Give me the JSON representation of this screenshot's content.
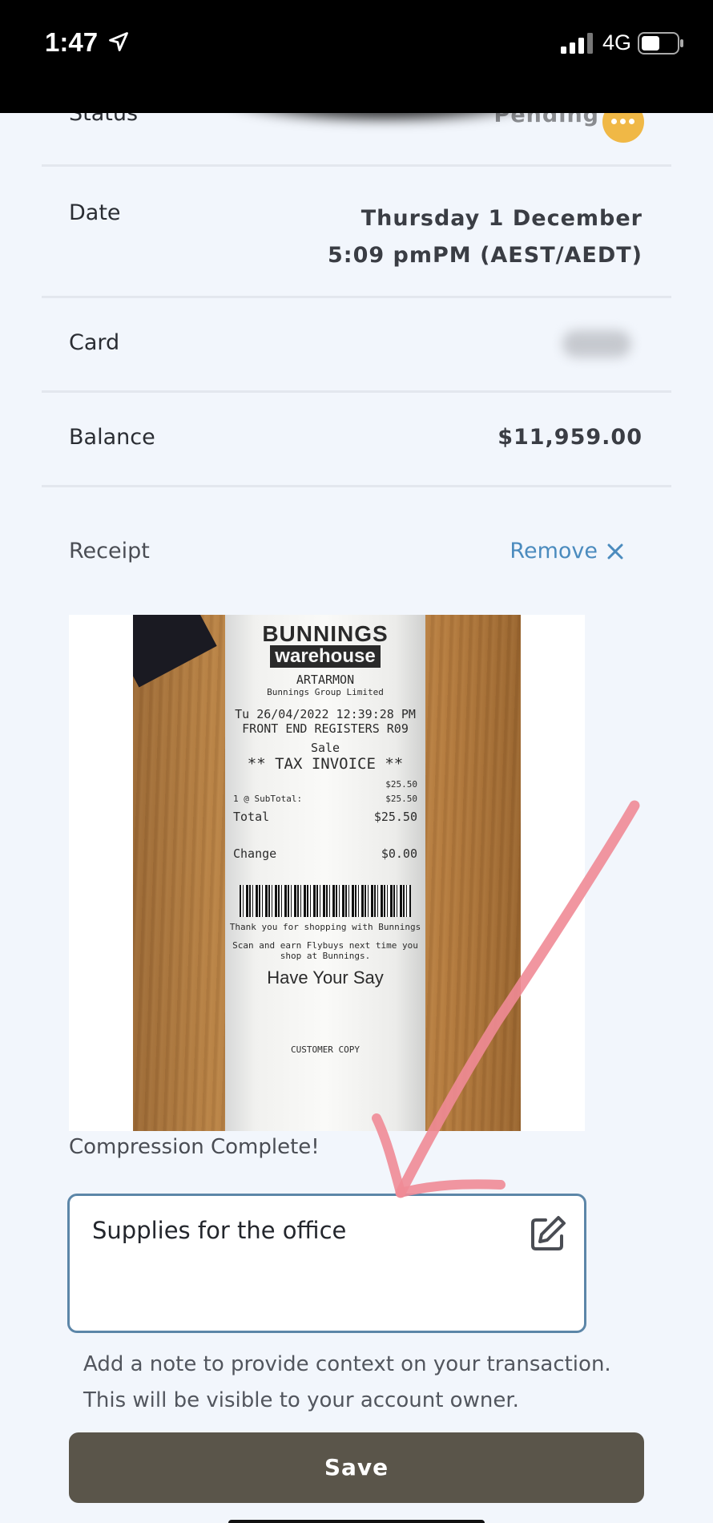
{
  "status_bar": {
    "time": "1:47",
    "network": "4G",
    "icons": [
      "location-arrow-icon",
      "signal-icon",
      "battery-icon"
    ]
  },
  "status_row": {
    "label": "Status",
    "value": "Pending",
    "icon": "more-dots-icon"
  },
  "date_row": {
    "label": "Date",
    "line1": "Thursday 1 December",
    "line2": "5:09 pmPM (AEST/AEDT)"
  },
  "card_row": {
    "label": "Card"
  },
  "balance_row": {
    "label": "Balance",
    "value": "$11,959.00"
  },
  "receipt": {
    "label": "Receipt",
    "remove_label": "Remove",
    "image": {
      "brand_line1": "BUNNINGS",
      "brand_line2": "warehouse",
      "store": "ARTARMON",
      "company": "Bunnings Group Limited",
      "datetime": "Tu 26/04/2022 12:39:28 PM",
      "registers": "FRONT END REGISTERS R09",
      "sale": "Sale",
      "tax_invoice": "** TAX INVOICE **",
      "item_price": "$25.50",
      "subtotal_label": "1 @ SubTotal:",
      "subtotal": "$25.50",
      "total_label": "Total",
      "total": "$25.50",
      "change_label": "Change",
      "change": "$0.00",
      "thanks": "Thank you for shopping with Bunnings",
      "flybuys": "Scan and earn Flybuys next time you shop at Bunnings.",
      "have_your_say": "Have Your Say",
      "customer_copy": "CUSTOMER COPY"
    }
  },
  "compression_status": "Compression Complete!",
  "note": {
    "value": "Supplies for the office",
    "icon": "edit-icon"
  },
  "helper_text": {
    "line1": "Add a note to provide context on your transaction.",
    "line2": "This will be visible to your account owner."
  },
  "save_label": "Save",
  "colors": {
    "accent": "#4b8bbe",
    "pending_badge": "#f0b846",
    "save_button": "#5a554a",
    "input_border": "#5c86a8",
    "annotation_arrow": "#f08b96"
  }
}
